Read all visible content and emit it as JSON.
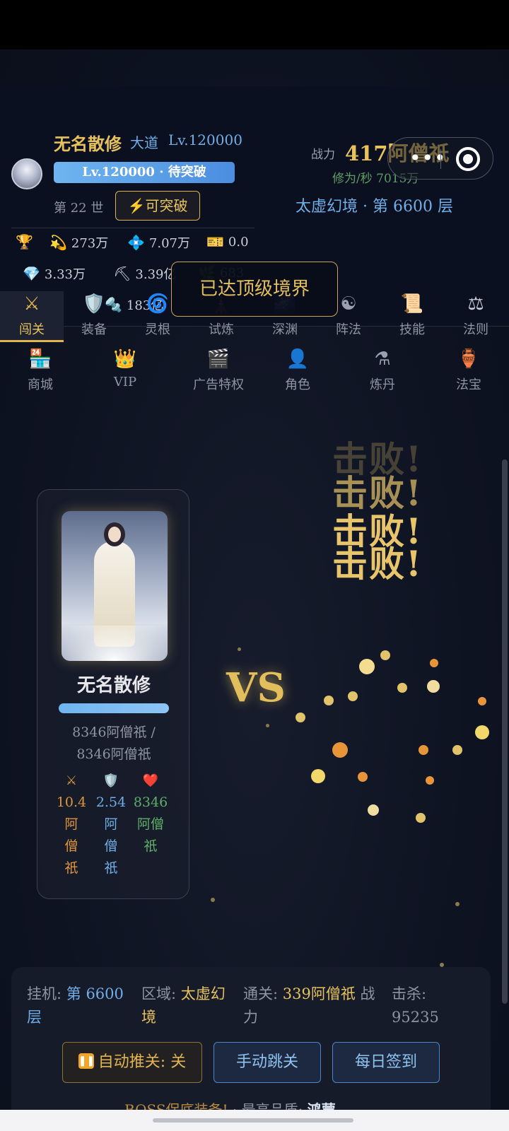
{
  "header": {
    "player_name": "无名散修",
    "dao_label": "大道",
    "level_label": "Lv.120000",
    "level_bar_text": "Lv.120000 · 待突破",
    "generation_text": "第 22 世",
    "breakthrough_button": "⚡可突破",
    "power_label": "战力",
    "power_value": "417阿僧祇",
    "cultivation_rate": "修为/秒 7015万",
    "realm_floor": "太虚幻境 · 第 6600 层"
  },
  "resources": [
    {
      "icon": "trophy-icon",
      "glyph": "🏆",
      "value": ""
    },
    {
      "icon": "comet-icon",
      "glyph": "💫",
      "value": "273万"
    },
    {
      "icon": "crystal-icon",
      "glyph": "💠",
      "value": "7.07万"
    },
    {
      "icon": "ticket-icon",
      "glyph": "🎫",
      "value": "0.0"
    },
    {
      "icon": "diamond-icon",
      "glyph": "💎",
      "value": "3.33万"
    },
    {
      "icon": "pickaxe-icon",
      "glyph": "⛏",
      "value": "3.39亿"
    },
    {
      "icon": "herb-icon",
      "glyph": "🌿",
      "value": "683"
    },
    {
      "icon": "screw-icon",
      "glyph": "🔩",
      "value": "183亿"
    }
  ],
  "toast": "已达顶级境界",
  "nav_row1": [
    {
      "icon": "sword-icon",
      "glyph": "⚔",
      "label": "闯关",
      "active": true
    },
    {
      "icon": "shield-icon",
      "glyph": "🛡️",
      "label": "装备"
    },
    {
      "icon": "swirl-icon",
      "glyph": "🌀",
      "label": "灵根"
    },
    {
      "icon": "tower-icon",
      "glyph": "🗼",
      "label": "试炼"
    },
    {
      "icon": "abyss-icon",
      "glyph": "🌌",
      "label": "深渊"
    },
    {
      "icon": "yin-yang-icon",
      "glyph": "☯",
      "label": "阵法"
    },
    {
      "icon": "scroll-icon",
      "glyph": "📜",
      "label": "技能"
    },
    {
      "icon": "scales-icon",
      "glyph": "⚖",
      "label": "法则"
    }
  ],
  "nav_row2": [
    {
      "icon": "store-icon",
      "glyph": "🏪",
      "label": "商城"
    },
    {
      "icon": "crown-icon",
      "glyph": "👑",
      "label": "VIP"
    },
    {
      "icon": "clapper-icon",
      "glyph": "🎬",
      "label": "广告特权"
    },
    {
      "icon": "person-icon",
      "glyph": "👤",
      "label": "角色"
    },
    {
      "icon": "flask-icon",
      "glyph": "⚗",
      "label": "炼丹"
    },
    {
      "icon": "vase-icon",
      "glyph": "🏺",
      "label": "法宝"
    }
  ],
  "player_card": {
    "name": "无名散修",
    "hp_fraction": 1.0,
    "hp_text_line1": "8346阿僧祇 /",
    "hp_text_line2": "8346阿僧祇",
    "attack": [
      "10.4",
      "阿",
      "僧",
      "祇"
    ],
    "defense": [
      "2.54",
      "阿",
      "僧",
      "祇"
    ],
    "health": [
      "8346",
      "阿僧",
      "祇"
    ],
    "colors": {
      "attack": "#e0953a",
      "defense": "#6faee6",
      "health": "#5fae6a"
    }
  },
  "battle": {
    "vs_text": "VS",
    "defeat_text": "击败!"
  },
  "bottom": {
    "idle_label": "挂机:",
    "idle_value_1": "第 6600",
    "idle_value_2": "层",
    "zone_label": "区域:",
    "zone_value_1": "太虚幻",
    "zone_value_2": "境",
    "clear_label": "通关:",
    "clear_value": "339阿僧祇",
    "clear_suffix_1": "战",
    "clear_suffix_2": "力",
    "kills_label": "击杀:",
    "kills_value": "95235",
    "auto_button": "自动推关: 关",
    "manual_button": "手动跳关",
    "signin_button": "每日签到",
    "boss_text": "BOSS保底装备!",
    "boss_sep": "·",
    "quality_label": "最高品质:",
    "quality_value": "鸿蒙"
  }
}
